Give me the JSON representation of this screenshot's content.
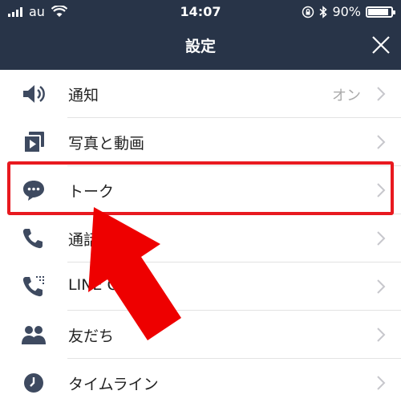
{
  "status_bar": {
    "carrier": "au",
    "time": "14:07",
    "battery": "90%",
    "battery_level": 0.9,
    "icons": [
      "signal-bars-icon",
      "wifi-icon",
      "rotation-lock-icon",
      "bluetooth-icon",
      "battery-icon"
    ]
  },
  "header": {
    "title": "設定",
    "close_icon": "close-icon"
  },
  "settings": {
    "items": [
      {
        "label": "通知",
        "value": "オン",
        "icon": "speaker-icon"
      },
      {
        "label": "写真と動画",
        "value": "",
        "icon": "photo-video-icon"
      },
      {
        "label": "トーク",
        "value": "",
        "icon": "chat-bubble-icon"
      },
      {
        "label": "通話",
        "value": "",
        "icon": "phone-icon"
      },
      {
        "label": "LINE Out",
        "value": "",
        "icon": "phone-out-icon"
      },
      {
        "label": "友だち",
        "value": "",
        "icon": "friends-icon"
      },
      {
        "label": "タイムライン",
        "value": "",
        "icon": "clock-icon"
      }
    ]
  },
  "annotation": {
    "highlight_color": "#e8191f",
    "arrow_color": "#ee0000",
    "target": "トーク"
  },
  "colors": {
    "header_bg": "#283448",
    "icon": "#3e4a60",
    "chevron": "#c7c7cc"
  }
}
